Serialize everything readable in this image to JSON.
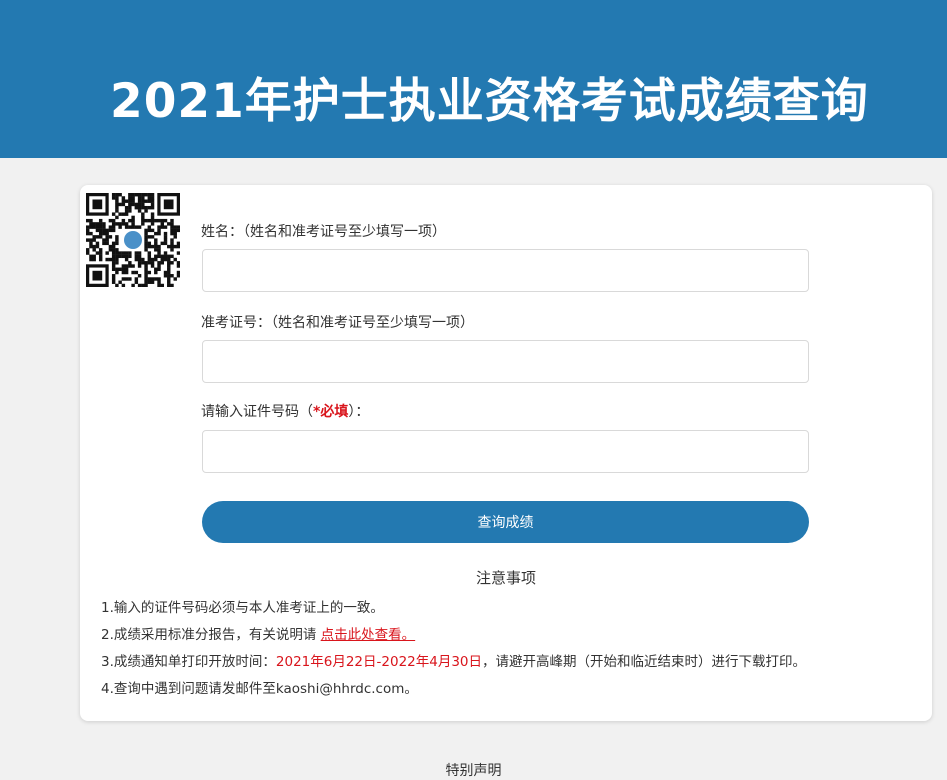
{
  "header": {
    "title": "2021年护士执业资格考试成绩查询"
  },
  "form": {
    "name_label": "姓名：（姓名和准考证号至少填写一项）",
    "name_value": "",
    "ticket_label": "准考证号：（姓名和准考证号至少填写一项）",
    "ticket_value": "",
    "id_label_prefix": "请输入证件号码（",
    "id_label_required": "*必填",
    "id_label_suffix": "）：",
    "id_value": "",
    "submit_label": "查询成绩"
  },
  "notes": {
    "title": "注意事项",
    "item1": "1.输入的证件号码必须与本人准考证上的一致。",
    "item2_prefix": "2.成绩采用标准分报告，有关说明请 ",
    "item2_link": "点击此处查看。",
    "item3_prefix": "3.成绩通知单打印开放时间：",
    "item3_dates": "2021年6月22日-2022年4月30日",
    "item3_suffix": "，请避开高峰期（开始和临近结束时）进行下载打印。",
    "item4": "4.查询中遇到问题请发邮件至kaoshi@hhrdc.com。"
  },
  "footer": {
    "title": "特别声明"
  },
  "colors": {
    "brand": "#2379b1",
    "required": "#d9151c",
    "background": "#f1f1f1"
  },
  "icons": {
    "qr": "qr-code-icon"
  }
}
